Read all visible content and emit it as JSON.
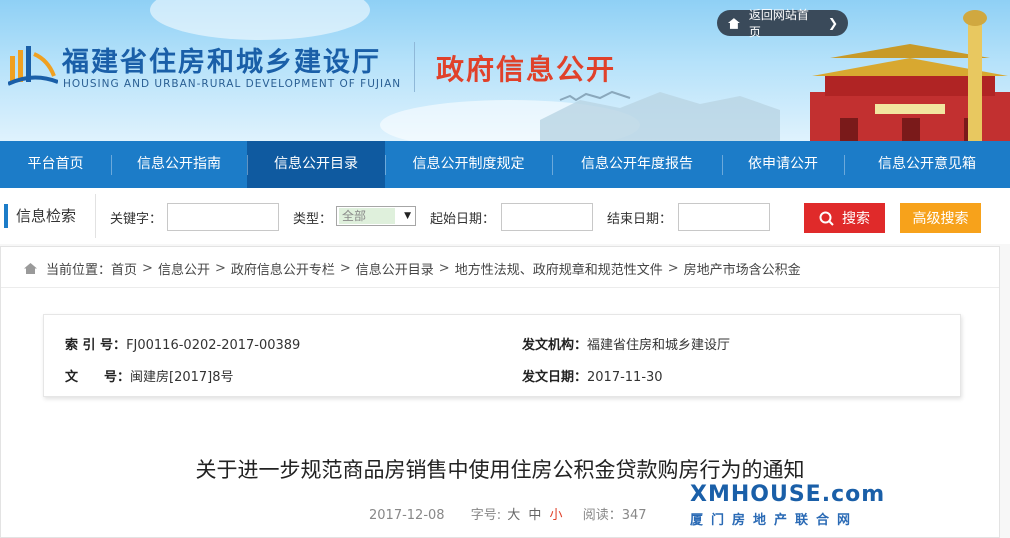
{
  "header": {
    "site_title": "福建省住房和城乡建设厅",
    "site_subtitle": "HOUSING AND URBAN-RURAL DEVELOPMENT OF FUJIAN",
    "section_title": "政府信息公开",
    "back_home_label": "返回网站首页",
    "brand_blue": "#1a5fa8",
    "accent_red": "#e0412a"
  },
  "nav": {
    "items": [
      {
        "label": "平台首页"
      },
      {
        "label": "信息公开指南"
      },
      {
        "label": "信息公开目录"
      },
      {
        "label": "信息公开制度规定"
      },
      {
        "label": "信息公开年度报告"
      },
      {
        "label": "依申请公开"
      },
      {
        "label": "信息公开意见箱"
      }
    ],
    "active_index": 2,
    "color": "#1c7cc8"
  },
  "search": {
    "title": "信息检索",
    "keyword_label": "关键字：",
    "keyword_value": "",
    "type_label": "类型：",
    "type_value": "全部",
    "start_label": "起始日期：",
    "start_value": "",
    "end_label": "结束日期：",
    "end_value": "",
    "search_button": "搜索",
    "advanced_button": "高级搜索"
  },
  "breadcrumb": {
    "prefix": "当前位置：",
    "items": [
      "首页",
      "信息公开",
      "政府信息公开专栏",
      "信息公开目录",
      "地方性法规、政府规章和规范性文件",
      "房地产市场含公积金"
    ]
  },
  "info": {
    "index_label": "索 引 号：",
    "index_value": "FJ00116-0202-2017-00389",
    "docno_label": "文　　号：",
    "docno_value": "闽建房[2017]8号",
    "issuer_label": "发文机构：",
    "issuer_value": "福建省住房和城乡建设厅",
    "date_label": "发文日期：",
    "date_value": "2017-11-30"
  },
  "document": {
    "title": "关于进一步规范商品房销售中使用住房公积金贷款购房行为的通知",
    "publish_date": "2017-12-08",
    "font_size_label": "字号:",
    "size_large": "大",
    "size_medium": "中",
    "size_small": "小",
    "views_label": "阅读：",
    "views_value": "347"
  },
  "watermark": {
    "top": "XMHOUSE.com",
    "bottom": "厦门房地产联合网"
  }
}
